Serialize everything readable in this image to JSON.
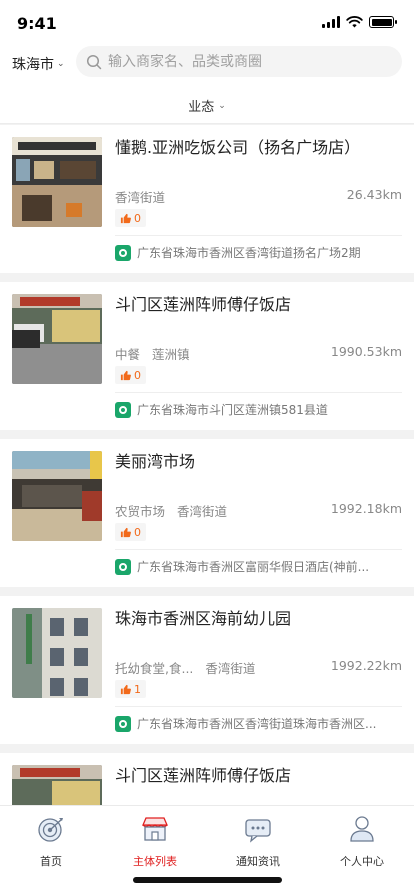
{
  "status_bar": {
    "time": "9:41"
  },
  "header": {
    "city": "珠海市",
    "search_placeholder": "输入商家名、品类或商圈"
  },
  "filter": {
    "label": "业态"
  },
  "merchants": [
    {
      "name": "懂鹅.亚洲吃饭公司（扬名广场店）",
      "tags": [
        "香湾街道"
      ],
      "distance": "26.43km",
      "likes": "0",
      "address": "广东省珠海市香洲区香湾街道扬名广场2期"
    },
    {
      "name": "斗门区莲洲阵师傅仔饭店",
      "tags": [
        "中餐",
        "莲洲镇"
      ],
      "distance": "1990.53km",
      "likes": "0",
      "address": "广东省珠海市斗门区莲洲镇581县道"
    },
    {
      "name": "美丽湾市场",
      "tags": [
        "农贸市场",
        "香湾街道"
      ],
      "distance": "1992.18km",
      "likes": "0",
      "address": "广东省珠海市香洲区富丽华假日酒店(神前..."
    },
    {
      "name": "珠海市香洲区海前幼儿园",
      "tags": [
        "托幼食堂,食...",
        "香湾街道"
      ],
      "distance": "1992.22km",
      "likes": "1",
      "address": "广东省珠海市香洲区香湾街道珠海市香洲区..."
    },
    {
      "name": "斗门区莲洲阵师傅仔饭店",
      "tags": [],
      "distance": "",
      "likes": "",
      "address": ""
    }
  ],
  "tabbar": {
    "items": [
      {
        "label": "首页",
        "icon": "target-icon",
        "active": false
      },
      {
        "label": "主体列表",
        "icon": "store-icon",
        "active": true
      },
      {
        "label": "通知资讯",
        "icon": "message-icon",
        "active": false
      },
      {
        "label": "个人中心",
        "icon": "user-icon",
        "active": false
      }
    ]
  },
  "colors": {
    "accent_red": "#e02020",
    "like_orange": "#f26a1b",
    "address_green": "#1aa66a"
  }
}
